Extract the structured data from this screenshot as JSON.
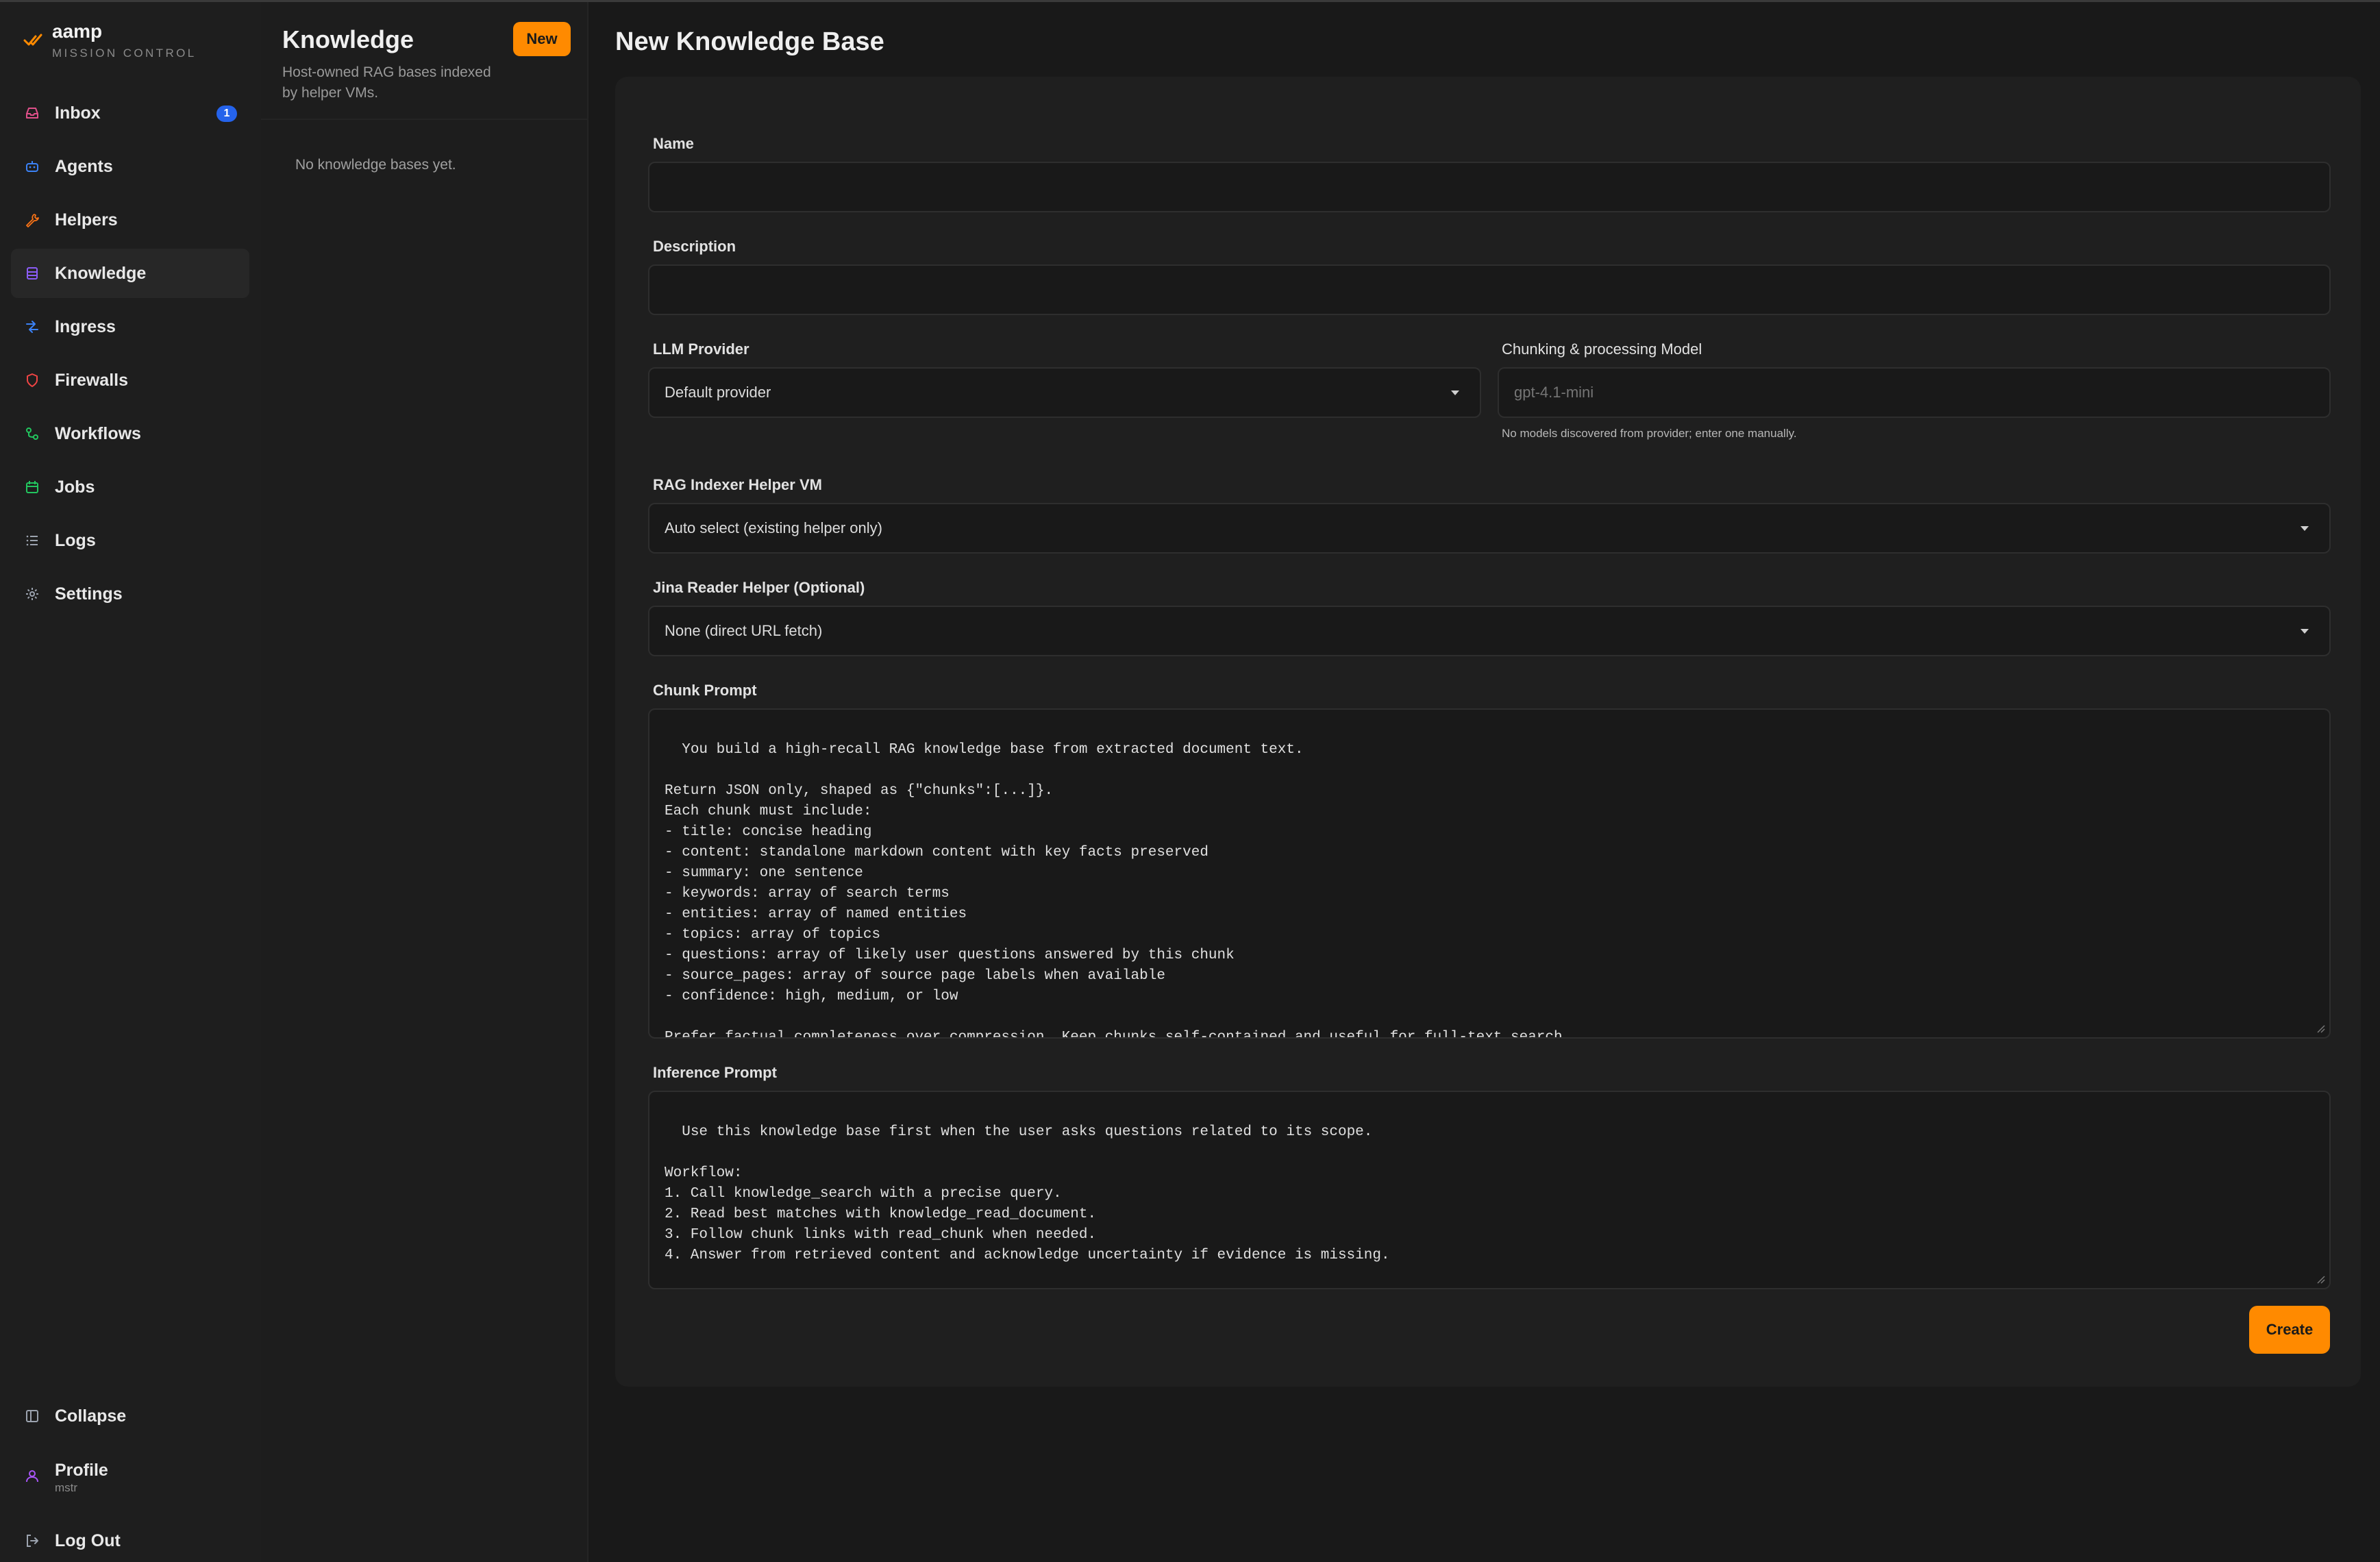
{
  "brand": {
    "name": "aamp",
    "subtitle": "MISSION CONTROL"
  },
  "sidebar": {
    "items": [
      {
        "label": "Inbox",
        "icon": "inbox-icon",
        "badge": "1"
      },
      {
        "label": "Agents",
        "icon": "bot-icon"
      },
      {
        "label": "Helpers",
        "icon": "wrench-icon"
      },
      {
        "label": "Knowledge",
        "icon": "database-icon",
        "active": true
      },
      {
        "label": "Ingress",
        "icon": "ingress-icon"
      },
      {
        "label": "Firewalls",
        "icon": "shield-icon"
      },
      {
        "label": "Workflows",
        "icon": "workflow-icon"
      },
      {
        "label": "Jobs",
        "icon": "calendar-icon"
      },
      {
        "label": "Logs",
        "icon": "list-icon"
      },
      {
        "label": "Settings",
        "icon": "gear-icon"
      }
    ],
    "collapse_label": "Collapse",
    "profile_label": "Profile",
    "profile_user": "mstr",
    "logout_label": "Log Out"
  },
  "list_panel": {
    "title": "Knowledge",
    "subtitle": "Host-owned RAG bases indexed by helper VMs.",
    "new_button": "New",
    "empty_text": "No knowledge bases yet."
  },
  "form": {
    "page_title": "New Knowledge Base",
    "name_label": "Name",
    "name_value": "",
    "description_label": "Description",
    "description_value": "",
    "provider_label": "LLM Provider",
    "provider_value": "Default provider",
    "model_label": "Chunking & processing Model",
    "model_placeholder": "gpt-4.1-mini",
    "model_hint": "No models discovered from provider; enter one manually.",
    "indexer_label": "RAG Indexer Helper VM",
    "indexer_value": "Auto select (existing helper only)",
    "jina_label": "Jina Reader Helper (Optional)",
    "jina_value": "None (direct URL fetch)",
    "chunk_prompt_label": "Chunk Prompt",
    "chunk_prompt_value": "You build a high-recall RAG knowledge base from extracted document text.\n\nReturn JSON only, shaped as {\"chunks\":[...]}.\nEach chunk must include:\n- title: concise heading\n- content: standalone markdown content with key facts preserved\n- summary: one sentence\n- keywords: array of search terms\n- entities: array of named entities\n- topics: array of topics\n- questions: array of likely user questions answered by this chunk\n- source_pages: array of source page labels when available\n- confidence: high, medium, or low\n\nPrefer factual completeness over compression. Keep chunks self-contained and useful for full-text search.",
    "inference_prompt_label": "Inference Prompt",
    "inference_prompt_value": "Use this knowledge base first when the user asks questions related to its scope.\n\nWorkflow:\n1. Call knowledge_search with a precise query.\n2. Read best matches with knowledge_read_document.\n3. Follow chunk links with read_chunk when needed.\n4. Answer from retrieved content and acknowledge uncertainty if evidence is missing.",
    "create_button": "Create"
  },
  "colors": {
    "accent": "#ff8a00",
    "badge": "#2563eb",
    "background": "#191919",
    "sidebar": "#1e1e1e",
    "card": "#1f1f1f"
  }
}
